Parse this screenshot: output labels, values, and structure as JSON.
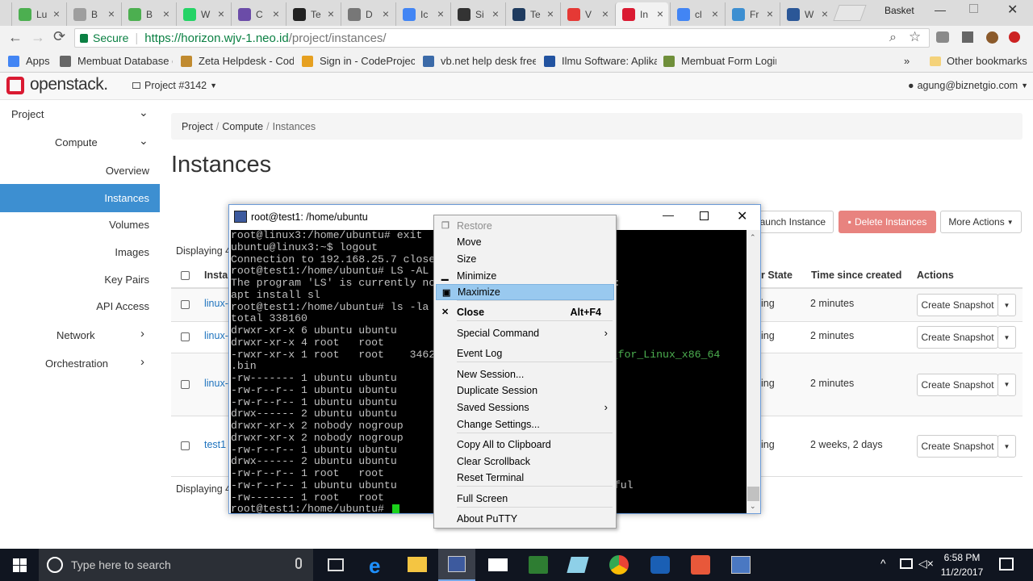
{
  "browser": {
    "tabs": [
      {
        "label": "Lu",
        "color": "#4caf50"
      },
      {
        "label": "B",
        "color": "#9e9e9e"
      },
      {
        "label": "B",
        "color": "#4caf50"
      },
      {
        "label": "W",
        "color": "#25d366"
      },
      {
        "label": "C",
        "color": "#6b4ca8"
      },
      {
        "label": "Te",
        "color": "#222222"
      },
      {
        "label": "D",
        "color": "#777777"
      },
      {
        "label": "Ic",
        "color": "#4285f4"
      },
      {
        "label": "Si",
        "color": "#333333"
      },
      {
        "label": "Te",
        "color": "#1f3b5f"
      },
      {
        "label": "V",
        "color": "#e53935"
      },
      {
        "label": "In",
        "color": "#da1a32"
      },
      {
        "label": "cl",
        "color": "#4285f4"
      },
      {
        "label": "Fr",
        "color": "#3d8fd1"
      },
      {
        "label": "W",
        "color": "#2b5797"
      }
    ],
    "profile_label": "Basket",
    "url_secure": "Secure",
    "url_host": "https://horizon.wjv-1.neo.id",
    "url_path": "/project/instances/",
    "bookmarks": [
      "Apps",
      "Membuat Database d",
      "Zeta Helpdesk - Code",
      "Sign in - CodeProject",
      "vb.net help desk free",
      "Ilmu Software: Aplika",
      "Membuat Form Login"
    ],
    "bookmarks_more": "»",
    "other_bookmarks": "Other bookmarks"
  },
  "openstack": {
    "logo": "openstack.",
    "project_selector": "Project #3142",
    "user": "agung@biznetgio.com"
  },
  "sidebar": {
    "project": "Project",
    "compute": "Compute",
    "items": [
      "Overview",
      "Instances",
      "Volumes",
      "Images",
      "Key Pairs",
      "API Access"
    ],
    "network": "Network",
    "orchestration": "Orchestration"
  },
  "content": {
    "breadcrumb": [
      "Project",
      "Compute",
      "Instances"
    ],
    "title": "Instances",
    "launch_button": "Launch Instance",
    "delete_button": "Delete Instances",
    "more_actions": "More Actions",
    "displaying_top": "Displaying 4",
    "displaying_bottom": "Displaying 4",
    "columns": {
      "name": "Instar",
      "power_state": "r State",
      "time": "Time since created",
      "actions": "Actions"
    },
    "rows": [
      {
        "name": "linux-",
        "state": "ing",
        "time": "2 minutes",
        "action": "Create Snapshot"
      },
      {
        "name": "linux-",
        "state": "ing",
        "time": "2 minutes",
        "action": "Create Snapshot"
      },
      {
        "name": "linux-",
        "state": "ing",
        "time": "2 minutes",
        "action": "Create Snapshot"
      },
      {
        "name": "test1",
        "state": "ing",
        "time": "2 weeks, 2 days",
        "action": "Create Snapshot"
      }
    ]
  },
  "putty": {
    "title": "root@test1: /home/ubuntu",
    "lines": [
      "root@linux3:/home/ubuntu# exit",
      "ubuntu@linux3:~$ logout",
      "Connection to 192.168.25.7 close",
      "root@test1:/home/ubuntu# LS -AL",
      "The program 'LS' is currently no                it by typing:",
      "apt install sl",
      "root@test1:/home/ubuntu# ls -la",
      "total 338160",
      "drwxr-xr-x 6 ubuntu ubuntu",
      "drwxr-xr-x 4 root   root",
      "-rwxr-xr-x 1 root   root    3462",
      ".bin",
      "-rw------- 1 ubuntu ubuntu                     tory",
      "-rw-r--r-- 1 ubuntu ubuntu                     out",
      "-rw-r--r-- 1 ubuntu ubuntu",
      "drwx------ 2 ubuntu ubuntu",
      "drwxr-xr-x 2 nobody nogroup",
      "drwxr-xr-x 2 nobody nogroup",
      "-rw-r--r-- 1 ubuntu ubuntu",
      "drwx------ 2 ubuntu ubuntu",
      "-rw-r--r-- 1 root   root",
      "-rw-r--r-- 1 ubuntu ubuntu                     admin_successful",
      "-rw------- 1 root   root",
      "root@test1:/home/ubuntu# "
    ],
    "green_fragment": "ent_for_Linux_x86_64",
    "green_bin": ".bin"
  },
  "context_menu": {
    "items": [
      {
        "label": "Restore",
        "disabled": true,
        "icon": "restore"
      },
      {
        "label": "Move"
      },
      {
        "label": "Size"
      },
      {
        "label": "Minimize",
        "icon": "minimize"
      },
      {
        "label": "Maximize",
        "icon": "maximize",
        "highlighted": true
      },
      {
        "label": "Close",
        "shortcut": "Alt+F4",
        "bold": true,
        "icon": "close"
      },
      {
        "label": "Special Command",
        "submenu": true
      },
      {
        "label": "Event Log"
      },
      {
        "label": "New Session..."
      },
      {
        "label": "Duplicate Session"
      },
      {
        "label": "Saved Sessions",
        "submenu": true
      },
      {
        "label": "Change Settings..."
      },
      {
        "label": "Copy All to Clipboard"
      },
      {
        "label": "Clear Scrollback"
      },
      {
        "label": "Reset Terminal"
      },
      {
        "label": "Full Screen"
      },
      {
        "label": "About PuTTY"
      }
    ]
  },
  "taskbar": {
    "search_placeholder": "Type here to search",
    "time": "6:58 PM",
    "date": "11/2/2017"
  },
  "colors": {
    "accent": "#3d8fd1",
    "danger": "#e8837f",
    "link": "#1e73be",
    "openstack_red": "#da1a32"
  }
}
